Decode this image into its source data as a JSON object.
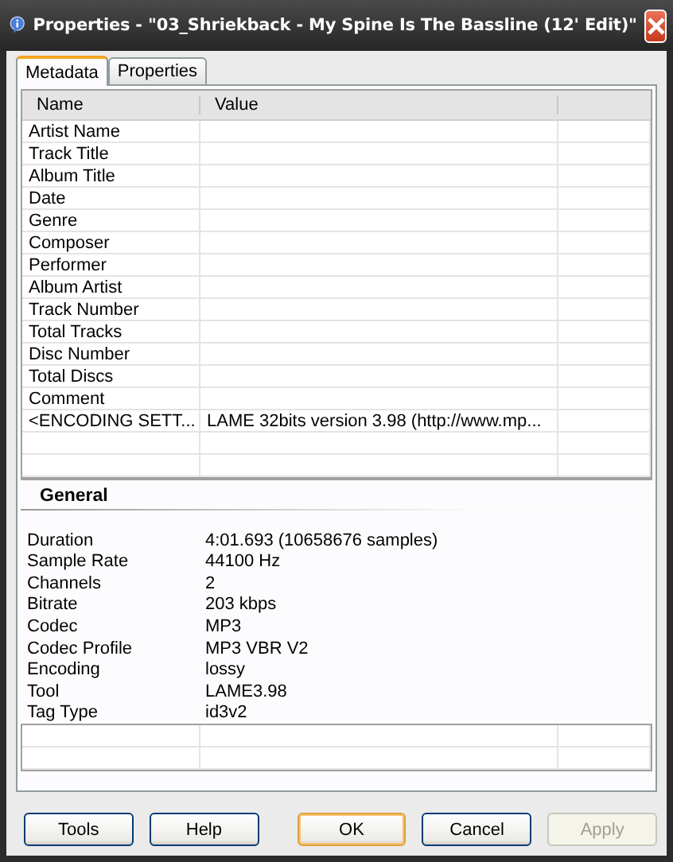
{
  "window": {
    "title": "Properties - \"03_Shriekback - My Spine Is The Bassline (12' Edit)\""
  },
  "tabs": [
    {
      "label": "Metadata",
      "selected": true
    },
    {
      "label": "Properties",
      "selected": false
    }
  ],
  "metadata": {
    "columns": [
      "Name",
      "Value"
    ],
    "rows": [
      {
        "name": "Artist Name",
        "value": ""
      },
      {
        "name": "Track Title"
      },
      {
        "name": "Album Title"
      },
      {
        "name": "Date"
      },
      {
        "name": "Genre"
      },
      {
        "name": "Composer"
      },
      {
        "name": "Performer"
      },
      {
        "name": "Album Artist"
      },
      {
        "name": "Track Number"
      },
      {
        "name": "Total Tracks"
      },
      {
        "name": "Disc Number"
      },
      {
        "name": "Total Discs"
      },
      {
        "name": "Comment"
      },
      {
        "name": "<ENCODING SETT...",
        "value": "LAME 32bits version 3.98 (http://www.mp..."
      }
    ]
  },
  "general": {
    "title": "General",
    "rows": [
      {
        "label": "Duration",
        "value": "4:01.693 (10658676 samples)"
      },
      {
        "label": "Sample Rate",
        "value": "44100 Hz"
      },
      {
        "label": "Channels",
        "value": "2"
      },
      {
        "label": "Bitrate",
        "value": "203 kbps"
      },
      {
        "label": "Codec",
        "value": "MP3"
      },
      {
        "label": "Codec Profile",
        "value": "MP3 VBR V2"
      },
      {
        "label": "Encoding",
        "value": "lossy"
      },
      {
        "label": "Tool",
        "value": "LAME3.98"
      },
      {
        "label": "Tag Type",
        "value": "id3v2"
      }
    ]
  },
  "buttons": [
    {
      "label": "Tools",
      "default": false,
      "disabled": false
    },
    {
      "label": "Help",
      "default": false,
      "disabled": false
    },
    {
      "label": "OK",
      "default": true,
      "disabled": false
    },
    {
      "label": "Cancel",
      "default": false,
      "disabled": false
    },
    {
      "label": "Apply",
      "default": false,
      "disabled": true
    }
  ]
}
